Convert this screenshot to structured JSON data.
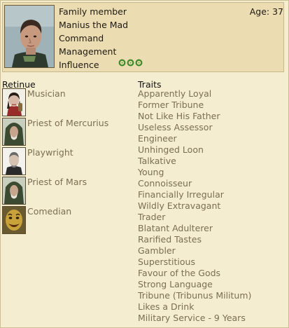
{
  "character": {
    "relation": "Family member",
    "name": "Manius the Mad",
    "age_label": "Age: 37",
    "attributes": [
      {
        "label": "Command"
      },
      {
        "label": "Management"
      },
      {
        "label": "Influence",
        "pips": 3
      }
    ]
  },
  "retinue": {
    "heading": "Retinue",
    "items": [
      {
        "label": "Musician",
        "icon": "musician-icon"
      },
      {
        "label": "Priest of Mercurius",
        "icon": "priest-hooded-icon"
      },
      {
        "label": "Playwright",
        "icon": "playwright-icon"
      },
      {
        "label": "Priest of Mars",
        "icon": "priest-hooded-icon"
      },
      {
        "label": "Comedian",
        "icon": "comedian-mask-icon"
      }
    ]
  },
  "traits": {
    "heading": "Traits",
    "items": [
      "Apparently Loyal",
      "Former Tribune",
      "Not Like His Father",
      "Useless Assessor",
      "Engineer",
      "Unhinged Loon",
      "Talkative",
      "Young",
      "Connoisseur",
      "Financially Irregular",
      "Wildly Extravagant",
      "Trader",
      "Blatant Adulterer",
      "Rarified Tastes",
      "Gambler",
      "Superstitious",
      "Favour of the Gods",
      "Strong Language",
      "Tribune (Tribunus Militum)",
      "Likes a Drink",
      "Military Service - 9 Years"
    ]
  },
  "colors": {
    "background": "#f4edd0",
    "header_panel": "#ebdcb2",
    "trait_text": "#7a6e55",
    "influence_pip": "#3f8a2a"
  }
}
